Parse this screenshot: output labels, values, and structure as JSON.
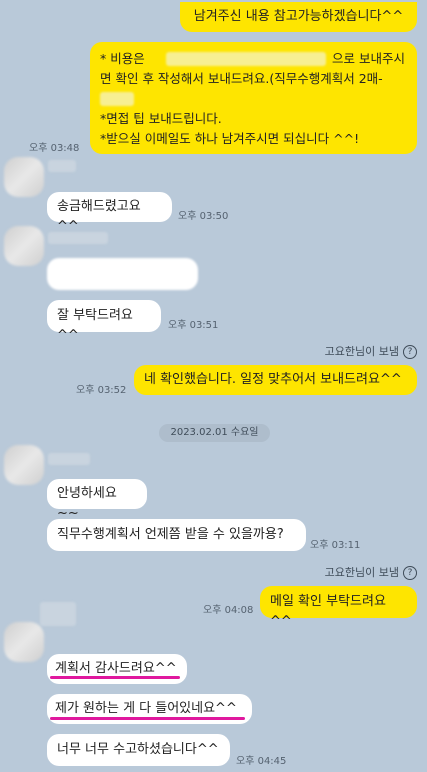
{
  "messages": {
    "m1": "남겨주신 내용 참고가능하겠습니다^^",
    "m2_l1a": "* 비용은",
    "m2_l1b": "으로 보내주시",
    "m2_l2": "면 확인 후 작성해서 보내드려요.(직무수행계획서 2매-",
    "m2_l4": "*면접 팁 보내드립니다.",
    "m2_l5": "*받으실 이메일도 하나 남겨주시면 되십니다 ^^!",
    "m2_time": "오후 03:48",
    "m3": "송금해드렸고요^^",
    "m3_time": "오후 03:50",
    "m4": "잘 부탁드려요^^",
    "m4_time": "오후 03:51",
    "read_by_1": "고요한님이 보냄",
    "m5": "네 확인했습니다. 일정 맞추어서 보내드려요^^",
    "m5_time": "오후 03:52",
    "date_separator": "2023.02.01 수요일",
    "m6": "안녕하세요~~",
    "m7": "직무수행계획서 언제쯤 받을 수 있을까용?",
    "m7_time": "오후 03:11",
    "read_by_2": "고요한님이 보냄",
    "m8": "메일 확인 부탁드려요^^",
    "m8_time": "오후 04:08",
    "m9": "계획서 감사드려요^^",
    "m10": "제가 원하는 게 다 들어있네요^^",
    "m11": "너무 너무 수고하셨습니다^^",
    "m11_time": "오후 04:45",
    "help_glyph": "?"
  },
  "colors": {
    "background": "#b9c9d9",
    "my_bubble": "#fee500",
    "their_bubble": "#ffffff",
    "highlight_underline": "#e0189e"
  },
  "icons": {
    "help": "question-circle-icon"
  }
}
